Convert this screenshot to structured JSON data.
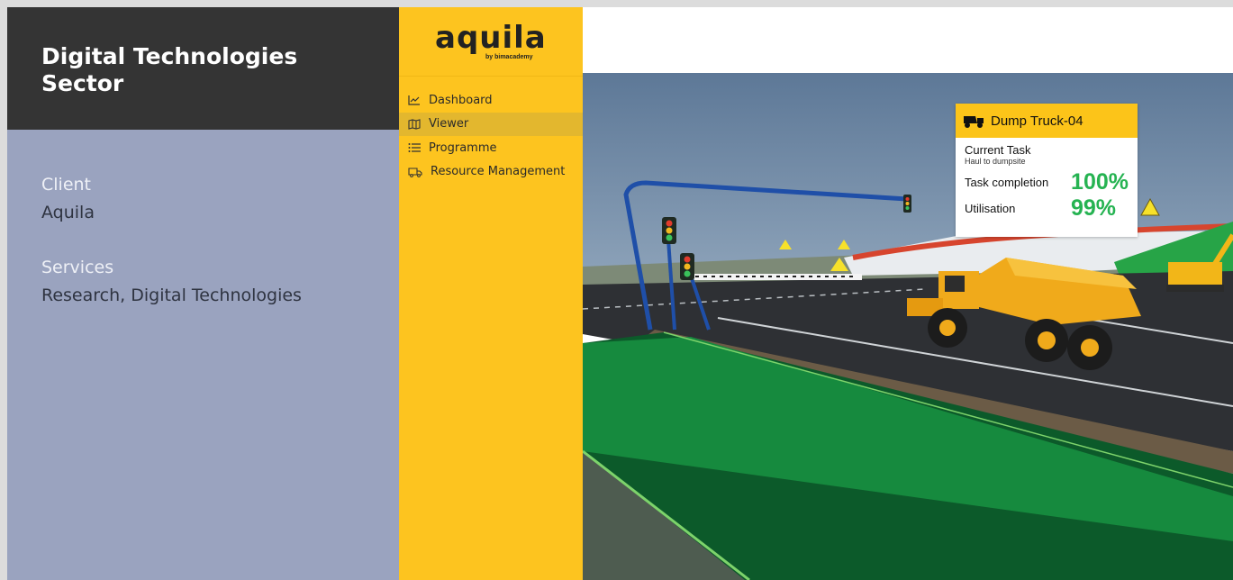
{
  "project": {
    "title": "Digital Technologies Sector",
    "client_label": "Client",
    "client_value": "Aquila",
    "services_label": "Services",
    "services_value": "Research, Digital Technologies"
  },
  "app": {
    "logo_text": "aquila",
    "logo_sub": "by bimacademy",
    "nav": [
      {
        "label": "Dashboard",
        "icon": "chart-line-icon"
      },
      {
        "label": "Viewer",
        "icon": "map-icon",
        "active": true
      },
      {
        "label": "Programme",
        "icon": "list-icon"
      },
      {
        "label": "Resource Management",
        "icon": "truck-icon"
      }
    ]
  },
  "card": {
    "title": "Dump Truck-04",
    "current_task_label": "Current Task",
    "current_task_value": "Haul to dumpsite",
    "task_completion_label": "Task completion",
    "task_completion_value": "100%",
    "utilisation_label": "Utilisation",
    "utilisation_value": "99%",
    "value_color": "#26b352",
    "header_color": "#fcc419"
  },
  "colors": {
    "sidebar": "#fdc41f",
    "panel": "#9aa3bf",
    "panel_header": "#343434"
  }
}
